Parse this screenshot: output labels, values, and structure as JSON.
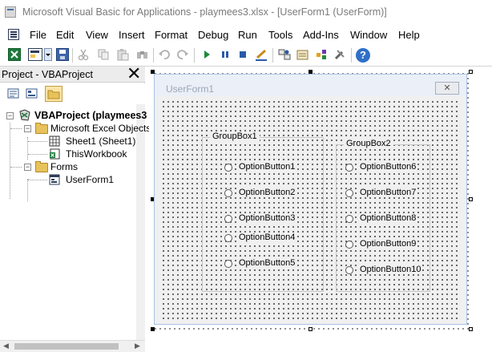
{
  "window": {
    "title": "Microsoft Visual Basic for Applications - playmees3.xlsx - [UserForm1 (UserForm)]"
  },
  "menu": {
    "items": [
      {
        "label": "File"
      },
      {
        "label": "Edit"
      },
      {
        "label": "View"
      },
      {
        "label": "Insert"
      },
      {
        "label": "Format"
      },
      {
        "label": "Debug"
      },
      {
        "label": "Run"
      },
      {
        "label": "Tools"
      },
      {
        "label": "Add-Ins"
      },
      {
        "label": "Window"
      },
      {
        "label": "Help"
      }
    ]
  },
  "toolbar": {
    "icons": [
      "view-excel-icon",
      "insert-userform-icon",
      "dropdown-arrow-icon",
      "save-icon",
      "cut-icon",
      "copy-icon",
      "paste-icon",
      "find-icon",
      "undo-icon",
      "redo-icon",
      "run-icon",
      "break-icon",
      "reset-icon",
      "design-mode-icon",
      "project-explorer-icon",
      "properties-window-icon",
      "object-browser-icon",
      "toolbox-icon",
      "help-icon"
    ]
  },
  "project_pane": {
    "title": "Project - VBAProject",
    "close_glyph": "✕",
    "tree": {
      "root": "VBAProject (playmees3",
      "excel_objects": "Microsoft Excel Objects",
      "sheet1": "Sheet1 (Sheet1)",
      "thisworkbook": "ThisWorkbook",
      "forms": "Forms",
      "userform1": "UserForm1"
    }
  },
  "userform": {
    "caption": "UserForm1",
    "close_glyph": "✕",
    "groupbox1": {
      "label": "GroupBox1",
      "options": [
        "OptionButton1",
        "OptionButton2",
        "OptionButton3",
        "OptionButton4",
        "OptionButton5"
      ]
    },
    "groupbox2": {
      "label": "GroupBox2",
      "options": [
        "OptionButton6",
        "OptionButton7",
        "OptionButton8",
        "OptionButton9",
        "OptionButton10"
      ]
    }
  },
  "colors": {
    "accent": "#1e7a3c",
    "form_border": "#aac3e6",
    "form_caption": "#9aa6ba"
  }
}
